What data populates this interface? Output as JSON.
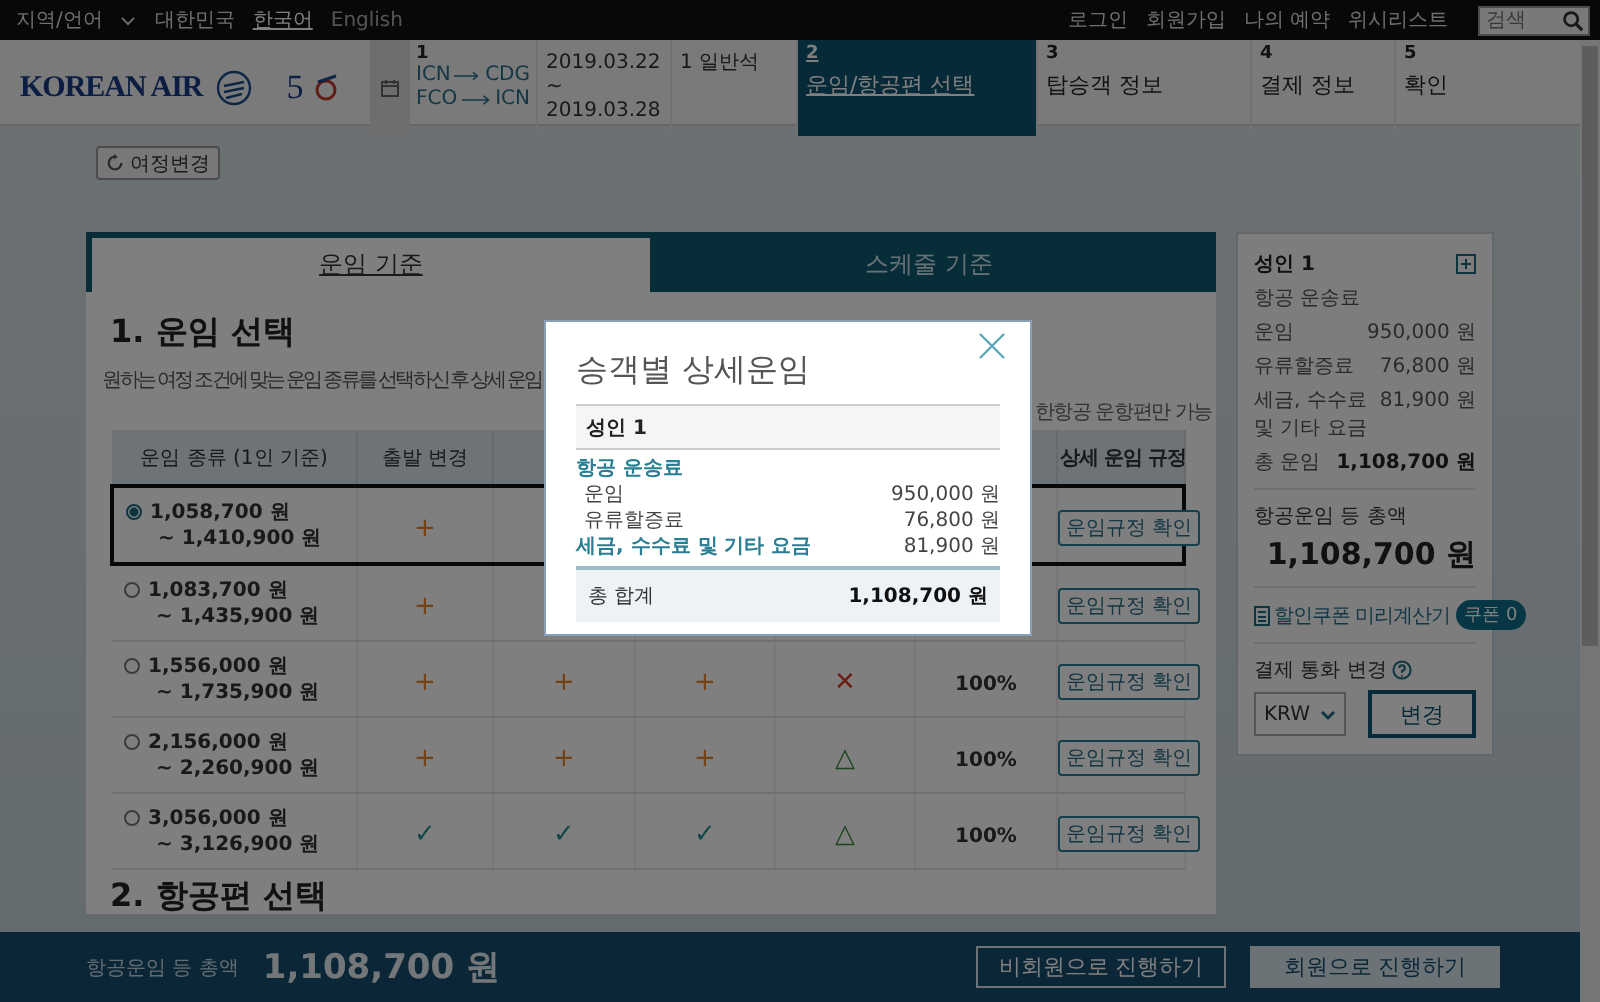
{
  "top_bar": {
    "region_label": "지역/언어",
    "country": "대한민국",
    "languages": [
      {
        "label": "한국어",
        "selected": true
      },
      {
        "label": "English",
        "selected": false
      }
    ],
    "links": [
      "로그인",
      "회원가입",
      "나의 예약",
      "위시리스트"
    ],
    "search": {
      "placeholder": "검색"
    }
  },
  "header": {
    "logo": "KOREAN AIR",
    "anniversary_logo": "5",
    "trip": {
      "step": "1",
      "legs": [
        {
          "from": "ICN",
          "to": "CDG"
        },
        {
          "from": "FCO",
          "to": "ICN"
        }
      ],
      "dates": "2019.03.22 ~ 2019.03.28",
      "cabin": "1 일반석"
    },
    "steps": [
      {
        "number": "2",
        "label": "운임/항공편 선택",
        "selected": true
      },
      {
        "number": "3",
        "label": "탑승객 정보",
        "selected": false
      },
      {
        "number": "4",
        "label": "결제 정보",
        "selected": false
      },
      {
        "number": "5",
        "label": "확인",
        "selected": false
      }
    ]
  },
  "change_itinerary_button": "여정변경",
  "tabs": [
    {
      "label": "운임 기준",
      "selected": true
    },
    {
      "label": "스케줄 기준",
      "selected": false
    }
  ],
  "fare_section": {
    "title": "1. 운임 선택",
    "description": "원하는 여정 조건에 맞는 운임 종류를 선택하신 후 상세 운임",
    "note": "한항공 운항편만 가능",
    "columns": [
      "운임 종류 (1인 기준)",
      "출발 변경",
      "상세 운임 규정"
    ],
    "rows": [
      {
        "selected": true,
        "fare": "1,058,700 원",
        "fare_max": "~ 1,410,900 원",
        "marks": [
          {
            "kind": "plus",
            "symbol": "+"
          }
        ],
        "rules_button": "운임규정 확인"
      },
      {
        "selected": false,
        "fare": "1,083,700 원",
        "fare_max": "~ 1,435,900 원",
        "marks": [
          {
            "kind": "plus",
            "symbol": "+"
          }
        ],
        "rules_button": "운임규정 확인"
      },
      {
        "selected": false,
        "fare": "1,556,000 원",
        "fare_max": "~ 1,735,900 원",
        "marks": [
          {
            "kind": "plus",
            "symbol": "+"
          },
          {
            "kind": "plus",
            "symbol": "+"
          },
          {
            "kind": "plus",
            "symbol": "+"
          },
          {
            "kind": "cross",
            "symbol": "✕"
          }
        ],
        "rate": "100%",
        "rules_button": "운임규정 확인"
      },
      {
        "selected": false,
        "fare": "2,156,000 원",
        "fare_max": "~ 2,260,900 원",
        "marks": [
          {
            "kind": "plus",
            "symbol": "+"
          },
          {
            "kind": "plus",
            "symbol": "+"
          },
          {
            "kind": "plus",
            "symbol": "+"
          },
          {
            "kind": "triangle",
            "symbol": "△"
          }
        ],
        "rate": "100%",
        "rules_button": "운임규정 확인"
      },
      {
        "selected": false,
        "fare": "3,056,000 원",
        "fare_max": "~ 3,126,900 원",
        "marks": [
          {
            "kind": "check",
            "symbol": "✓"
          },
          {
            "kind": "check",
            "symbol": "✓"
          },
          {
            "kind": "check",
            "symbol": "✓"
          },
          {
            "kind": "triangle",
            "symbol": "△"
          }
        ],
        "rate": "100%",
        "rules_button": "운임규정 확인"
      }
    ]
  },
  "section2_title": "2. 항공편 선택",
  "summary": {
    "passenger": "성인 1",
    "group": "항공 운송료",
    "items": [
      {
        "label": "운임",
        "amount": "950,000 원"
      },
      {
        "label": "유류할증료",
        "amount": "76,800 원"
      },
      {
        "label": "세금, 수수료 및 기타 요금",
        "amount": "81,900 원"
      }
    ],
    "fare_total_label": "총 운임",
    "fare_total": "1,108,700 원",
    "grand_total_label": "항공운임 등 총액",
    "grand_total": "1,108,700 원",
    "coupon_link": "할인쿠폰 미리계산기",
    "coupon_badge": "쿠폰 0",
    "currency_label": "결제 통화 변경",
    "currency": "KRW",
    "change_button": "변경"
  },
  "bottom_bar": {
    "total_label": "항공운임 등 총액",
    "total": "1,108,700 원",
    "buttons": [
      {
        "label": "비회원으로 진행하기",
        "kind": "outline"
      },
      {
        "label": "회원으로 진행하기",
        "kind": "filled"
      }
    ]
  },
  "modal": {
    "title": "승객별 상세운임",
    "passenger": "성인 1",
    "rows": [
      {
        "kind": "group",
        "label": "항공 운송료"
      },
      {
        "kind": "item",
        "label": "운임",
        "amount": "950,000 원"
      },
      {
        "kind": "item",
        "label": "유류할증료",
        "amount": "76,800 원"
      },
      {
        "kind": "group",
        "label": "세금, 수수료 및 기타 요금",
        "amount": "81,900 원"
      }
    ],
    "total_label": "총 합계",
    "total": "1,108,700 원"
  }
}
